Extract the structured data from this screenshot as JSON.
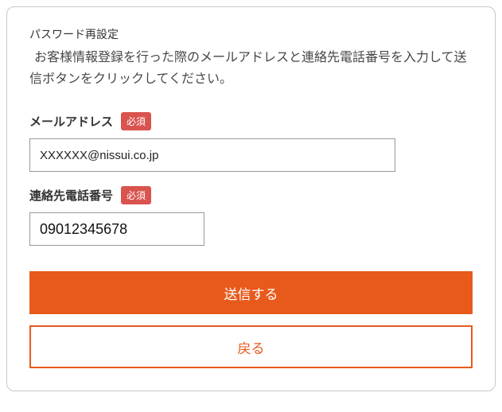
{
  "header": {
    "title": "パスワード再設定",
    "description": "お客様情報登録を行った際のメールアドレスと連絡先電話番号を入力して送信ボタンをクリックしてください。"
  },
  "fields": {
    "email": {
      "label": "メールアドレス",
      "required_badge": "必須",
      "value": "XXXXXX@nissui.co.jp"
    },
    "phone": {
      "label": "連絡先電話番号",
      "required_badge": "必須",
      "value": "09012345678"
    }
  },
  "buttons": {
    "submit": "送信する",
    "back": "戻る"
  }
}
